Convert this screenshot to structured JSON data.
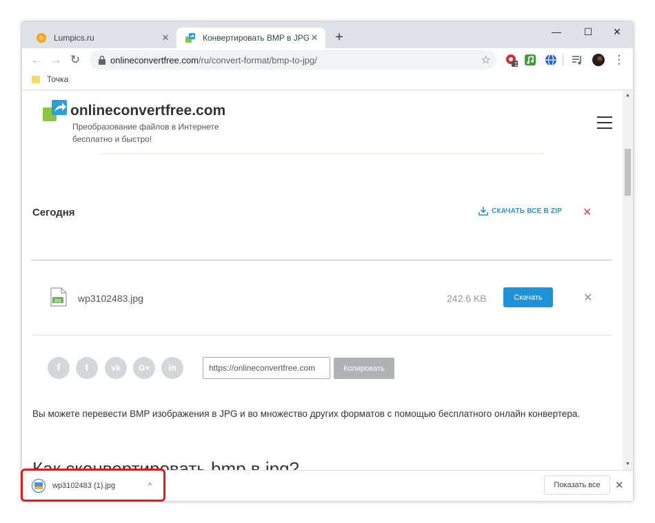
{
  "browser": {
    "tabs": [
      {
        "title": "Lumpics.ru",
        "active": false
      },
      {
        "title": "Конвертировать BMP в JPG онлайн бесплатно",
        "active": true
      }
    ],
    "new_tab": "+",
    "window_controls": {
      "minimize": "—",
      "maximize": "☐",
      "close": "✕"
    },
    "nav": {
      "back": "←",
      "forward": "→",
      "reload": "↻"
    },
    "url": {
      "host": "onlineconvertfree.com",
      "path": "/ru/convert-format/bmp-to-jpg/"
    },
    "star": "☆",
    "extension_badge": "1",
    "menu": "⋮",
    "bookmarks": [
      {
        "label": "Точка"
      }
    ]
  },
  "page": {
    "brand": {
      "name": "onlineconvertfree.com",
      "tagline": "Преобразование файлов в Интернете бесплатно и быстро!"
    },
    "today_label": "Сегодня",
    "download_all_label": "СКАЧАТЬ ВСЕ В ZIP",
    "clear_symbol": "✕",
    "file": {
      "icon_text": "jpg",
      "name": "wp3102483.jpg",
      "size": "242.6 KB",
      "download_label": "Скачать",
      "remove_symbol": "✕"
    },
    "social": [
      {
        "name": "facebook",
        "glyph": "f"
      },
      {
        "name": "twitter",
        "glyph": "t"
      },
      {
        "name": "vk",
        "glyph": "vk"
      },
      {
        "name": "google-plus",
        "glyph": "G+"
      },
      {
        "name": "linkedin",
        "glyph": "in"
      }
    ],
    "share_url": "https://onlineconvertfree.com",
    "copy_label": "Копировать",
    "paragraph": "Вы можете перевести BMP изображения в JPG и во множество других форматов с помощью бесплатного онлайн конвертера.",
    "heading": "Как сконвертировать bmp в jpg?"
  },
  "downloads_bar": {
    "file_name": "wp3102483 (1).jpg",
    "chevron": "^",
    "show_all_label": "Показать все",
    "close": "✕"
  },
  "colors": {
    "accent_blue": "#1f93d8",
    "clear_red": "#e0414f",
    "highlight_red": "#e11b1b",
    "chrome_titlebar": "#dee1e6"
  }
}
